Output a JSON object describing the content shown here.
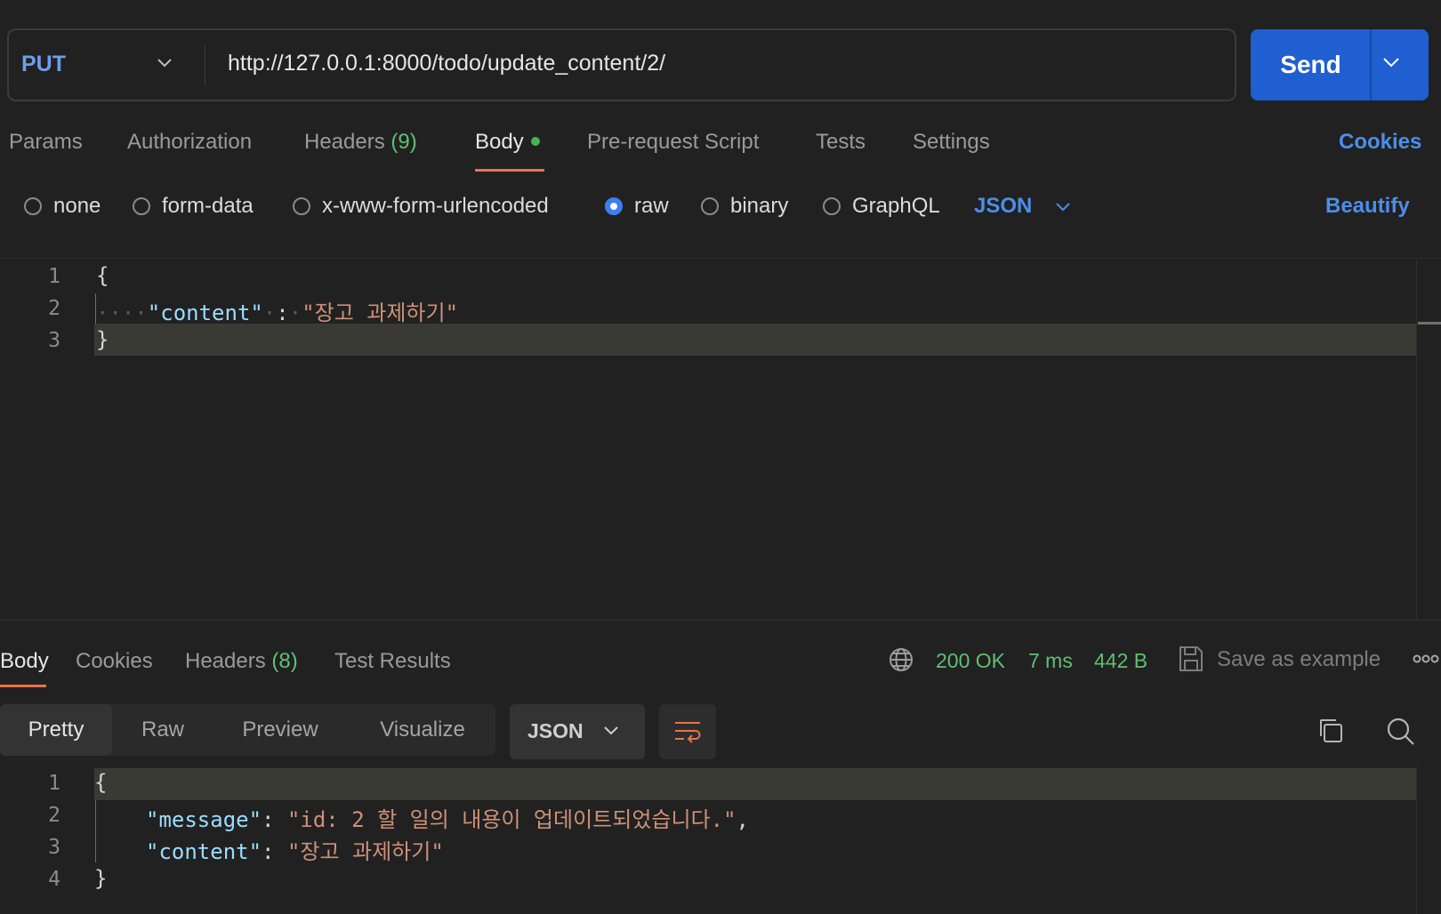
{
  "request": {
    "method": "PUT",
    "url": "http://127.0.0.1:8000/todo/update_content/2/",
    "send_label": "Send"
  },
  "request_tabs": {
    "params": "Params",
    "authorization": "Authorization",
    "headers": "Headers",
    "headers_count": "(9)",
    "body": "Body",
    "pre_request": "Pre-request Script",
    "tests": "Tests",
    "settings": "Settings",
    "cookies": "Cookies"
  },
  "body_types": {
    "none": "none",
    "form_data": "form-data",
    "urlencoded": "x-www-form-urlencoded",
    "raw": "raw",
    "binary": "binary",
    "graphql": "GraphQL",
    "selected": "raw",
    "format": "JSON",
    "beautify": "Beautify"
  },
  "request_body": {
    "line_numbers": [
      "1",
      "2",
      "3"
    ],
    "open_brace": "{",
    "key": "\"content\"",
    "colon": ":",
    "value": "\"장고 과제하기\"",
    "close_brace": "}"
  },
  "response_tabs": {
    "body": "Body",
    "cookies": "Cookies",
    "headers": "Headers",
    "headers_count": "(8)",
    "test_results": "Test Results"
  },
  "response_status": {
    "code": "200 OK",
    "time": "7 ms",
    "size": "442 B",
    "save_as_example": "Save as example"
  },
  "response_view": {
    "pretty": "Pretty",
    "raw": "Raw",
    "preview": "Preview",
    "visualize": "Visualize",
    "format": "JSON"
  },
  "response_body": {
    "line_numbers": [
      "1",
      "2",
      "3",
      "4"
    ],
    "open_brace": "{",
    "message_key": "\"message\"",
    "message_value": "\"id: 2 할 일의 내용이 업데이트되었습니다.\"",
    "content_key": "\"content\"",
    "content_value": "\"장고 과제하기\"",
    "close_brace": "}"
  },
  "colors": {
    "accent_blue": "#1f5fd1",
    "link_blue": "#4c8ee8",
    "active_underline": "#e8734a",
    "status_green": "#5fbf73",
    "background": "#212121"
  }
}
